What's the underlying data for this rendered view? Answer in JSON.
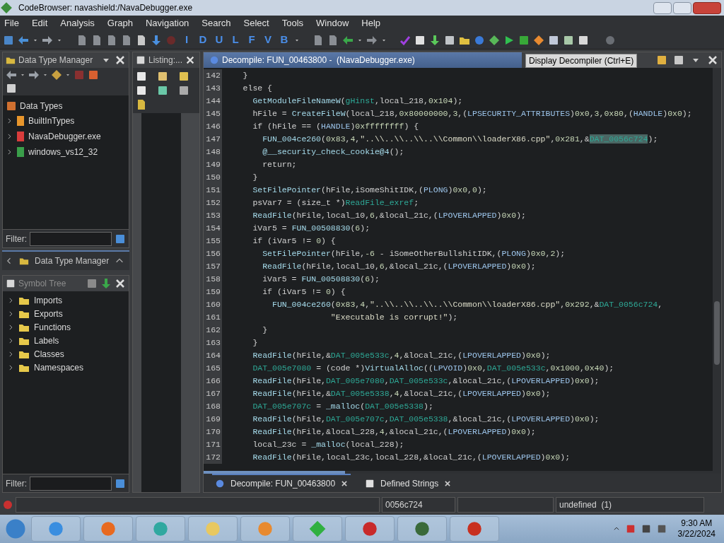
{
  "window": {
    "title": "CodeBrowser: navashield:/NavaDebugger.exe"
  },
  "menu": [
    "File",
    "Edit",
    "Analysis",
    "Graph",
    "Navigation",
    "Search",
    "Select",
    "Tools",
    "Window",
    "Help"
  ],
  "toolbar_letters": [
    "I",
    "D",
    "U",
    "L",
    "F",
    "V",
    "B"
  ],
  "tooltip": "Display Decompiler (Ctrl+E)",
  "data_type_manager": {
    "title": "Data Type Manager",
    "root": "Data Types",
    "filter_label": "Filter:",
    "items": [
      {
        "label": "BuiltInTypes",
        "color": "#e8962c"
      },
      {
        "label": "NavaDebugger.exe",
        "color": "#d83c3c"
      },
      {
        "label": "windows_vs12_32",
        "color": "#3a9e4a"
      }
    ]
  },
  "collapsed_panel": {
    "title": "Data Type Manager"
  },
  "symbol_tree": {
    "title": "Symbol Tree",
    "filter_label": "Filter:",
    "items": [
      "Imports",
      "Exports",
      "Functions",
      "Labels",
      "Classes",
      "Namespaces"
    ]
  },
  "listing": {
    "title": "Listing:..."
  },
  "decompile": {
    "title": "Decompile: FUN_00463800 -  (NavaDebugger.exe)",
    "lines": [
      {
        "n": "142",
        "tokens": [
          {
            "kind": "t",
            "text": "    }"
          }
        ]
      },
      {
        "n": "143",
        "tokens": [
          {
            "kind": "t",
            "text": "    else {"
          }
        ]
      },
      {
        "n": "144",
        "tokens": [
          {
            "kind": "f",
            "text": "      GetModuleFileNameW"
          },
          {
            "kind": "t",
            "text": "("
          },
          {
            "kind": "g",
            "text": "gHinst"
          },
          {
            "kind": "t",
            "text": ",local_218,"
          },
          {
            "kind": "n",
            "text": "0x104"
          },
          {
            "kind": "t",
            "text": ");"
          }
        ]
      },
      {
        "n": "145",
        "tokens": [
          {
            "kind": "t",
            "text": "      hFile = "
          },
          {
            "kind": "f",
            "text": "CreateFileW"
          },
          {
            "kind": "t",
            "text": "(local_218,"
          },
          {
            "kind": "n",
            "text": "0x80000000"
          },
          {
            "kind": "t",
            "text": ","
          },
          {
            "kind": "n",
            "text": "3"
          },
          {
            "kind": "t",
            "text": ",("
          },
          {
            "kind": "y",
            "text": "LPSECURITY_ATTRIBUTES"
          },
          {
            "kind": "t",
            "text": ")"
          },
          {
            "kind": "n",
            "text": "0x0"
          },
          {
            "kind": "t",
            "text": ","
          },
          {
            "kind": "n",
            "text": "3"
          },
          {
            "kind": "t",
            "text": ","
          },
          {
            "kind": "n",
            "text": "0x80"
          },
          {
            "kind": "t",
            "text": ",("
          },
          {
            "kind": "y",
            "text": "HANDLE"
          },
          {
            "kind": "t",
            "text": ")"
          },
          {
            "kind": "n",
            "text": "0x0"
          },
          {
            "kind": "t",
            "text": ");"
          }
        ]
      },
      {
        "n": "146",
        "tokens": [
          {
            "kind": "t",
            "text": "      if (hFile == ("
          },
          {
            "kind": "y",
            "text": "HANDLE"
          },
          {
            "kind": "t",
            "text": ")"
          },
          {
            "kind": "n",
            "text": "0xffffffff"
          },
          {
            "kind": "t",
            "text": ") {"
          }
        ]
      },
      {
        "n": "147",
        "tokens": [
          {
            "kind": "f",
            "text": "        FUN_004ce260"
          },
          {
            "kind": "t",
            "text": "("
          },
          {
            "kind": "n",
            "text": "0x83"
          },
          {
            "kind": "t",
            "text": ","
          },
          {
            "kind": "n",
            "text": "4"
          },
          {
            "kind": "t",
            "text": ","
          },
          {
            "kind": "s",
            "text": "\"..\\\\..\\\\..\\\\..\\\\Common\\\\loaderX86.cpp\""
          },
          {
            "kind": "t",
            "text": ","
          },
          {
            "kind": "n",
            "text": "0x281"
          },
          {
            "kind": "t",
            "text": ",&"
          },
          {
            "kind": "h",
            "text": "DAT_0056c724"
          },
          {
            "kind": "t",
            "text": ");"
          }
        ]
      },
      {
        "n": "148",
        "tokens": [
          {
            "kind": "f",
            "text": "        @__security_check_cookie@4"
          },
          {
            "kind": "t",
            "text": "();"
          }
        ]
      },
      {
        "n": "149",
        "tokens": [
          {
            "kind": "t",
            "text": "        return;"
          }
        ]
      },
      {
        "n": "150",
        "tokens": [
          {
            "kind": "t",
            "text": "      }"
          }
        ]
      },
      {
        "n": "151",
        "tokens": [
          {
            "kind": "f",
            "text": "      SetFilePointer"
          },
          {
            "kind": "t",
            "text": "(hFile,iSomeShitIDK,("
          },
          {
            "kind": "y",
            "text": "PLONG"
          },
          {
            "kind": "t",
            "text": ")"
          },
          {
            "kind": "n",
            "text": "0x0"
          },
          {
            "kind": "t",
            "text": ","
          },
          {
            "kind": "n",
            "text": "0"
          },
          {
            "kind": "t",
            "text": ");"
          }
        ]
      },
      {
        "n": "152",
        "tokens": [
          {
            "kind": "t",
            "text": "      psVar7 = (size_t *)"
          },
          {
            "kind": "g",
            "text": "ReadFile_exref"
          },
          {
            "kind": "t",
            "text": ";"
          }
        ]
      },
      {
        "n": "153",
        "tokens": [
          {
            "kind": "f",
            "text": "      ReadFile"
          },
          {
            "kind": "t",
            "text": "(hFile,local_10,"
          },
          {
            "kind": "n",
            "text": "6"
          },
          {
            "kind": "t",
            "text": ",&local_21c,("
          },
          {
            "kind": "y",
            "text": "LPOVERLAPPED"
          },
          {
            "kind": "t",
            "text": ")"
          },
          {
            "kind": "n",
            "text": "0x0"
          },
          {
            "kind": "t",
            "text": ");"
          }
        ]
      },
      {
        "n": "154",
        "tokens": [
          {
            "kind": "t",
            "text": "      iVar5 = "
          },
          {
            "kind": "f",
            "text": "FUN_00508830"
          },
          {
            "kind": "t",
            "text": "("
          },
          {
            "kind": "n",
            "text": "6"
          },
          {
            "kind": "t",
            "text": ");"
          }
        ]
      },
      {
        "n": "155",
        "tokens": [
          {
            "kind": "t",
            "text": "      if (iVar5 != "
          },
          {
            "kind": "n",
            "text": "0"
          },
          {
            "kind": "t",
            "text": ") {"
          }
        ]
      },
      {
        "n": "156",
        "tokens": [
          {
            "kind": "f",
            "text": "        SetFilePointer"
          },
          {
            "kind": "t",
            "text": "(hFile,"
          },
          {
            "kind": "n",
            "text": "-6"
          },
          {
            "kind": "t",
            "text": " - iSomeOtherBullshitIDK,("
          },
          {
            "kind": "y",
            "text": "PLONG"
          },
          {
            "kind": "t",
            "text": ")"
          },
          {
            "kind": "n",
            "text": "0x0"
          },
          {
            "kind": "t",
            "text": ","
          },
          {
            "kind": "n",
            "text": "2"
          },
          {
            "kind": "t",
            "text": ");"
          }
        ]
      },
      {
        "n": "157",
        "tokens": [
          {
            "kind": "f",
            "text": "        ReadFile"
          },
          {
            "kind": "t",
            "text": "(hFile,local_10,"
          },
          {
            "kind": "n",
            "text": "6"
          },
          {
            "kind": "t",
            "text": ",&local_21c,("
          },
          {
            "kind": "y",
            "text": "LPOVERLAPPED"
          },
          {
            "kind": "t",
            "text": ")"
          },
          {
            "kind": "n",
            "text": "0x0"
          },
          {
            "kind": "t",
            "text": ");"
          }
        ]
      },
      {
        "n": "158",
        "tokens": [
          {
            "kind": "t",
            "text": "        iVar5 = "
          },
          {
            "kind": "f",
            "text": "FUN_00508830"
          },
          {
            "kind": "t",
            "text": "("
          },
          {
            "kind": "n",
            "text": "6"
          },
          {
            "kind": "t",
            "text": ");"
          }
        ]
      },
      {
        "n": "159",
        "tokens": [
          {
            "kind": "t",
            "text": "        if (iVar5 != "
          },
          {
            "kind": "n",
            "text": "0"
          },
          {
            "kind": "t",
            "text": ") {"
          }
        ]
      },
      {
        "n": "160",
        "tokens": [
          {
            "kind": "f",
            "text": "          FUN_004ce260"
          },
          {
            "kind": "t",
            "text": "("
          },
          {
            "kind": "n",
            "text": "0x83"
          },
          {
            "kind": "t",
            "text": ","
          },
          {
            "kind": "n",
            "text": "4"
          },
          {
            "kind": "t",
            "text": ","
          },
          {
            "kind": "s",
            "text": "\"..\\\\..\\\\..\\\\..\\\\Common\\\\loaderX86.cpp\""
          },
          {
            "kind": "t",
            "text": ","
          },
          {
            "kind": "n",
            "text": "0x292"
          },
          {
            "kind": "t",
            "text": ",&"
          },
          {
            "kind": "g",
            "text": "DAT_0056c724"
          },
          {
            "kind": "t",
            "text": ","
          }
        ]
      },
      {
        "n": "161",
        "tokens": [
          {
            "kind": "s",
            "text": "                      \"Executable is corrupt!\""
          },
          {
            "kind": "t",
            "text": ");"
          }
        ]
      },
      {
        "n": "162",
        "tokens": [
          {
            "kind": "t",
            "text": "        }"
          }
        ]
      },
      {
        "n": "163",
        "tokens": [
          {
            "kind": "t",
            "text": "      }"
          }
        ]
      },
      {
        "n": "164",
        "tokens": [
          {
            "kind": "f",
            "text": "      ReadFile"
          },
          {
            "kind": "t",
            "text": "(hFile,&"
          },
          {
            "kind": "g",
            "text": "DAT_005e533c"
          },
          {
            "kind": "t",
            "text": ","
          },
          {
            "kind": "n",
            "text": "4"
          },
          {
            "kind": "t",
            "text": ",&local_21c,("
          },
          {
            "kind": "y",
            "text": "LPOVERLAPPED"
          },
          {
            "kind": "t",
            "text": ")"
          },
          {
            "kind": "n",
            "text": "0x0"
          },
          {
            "kind": "t",
            "text": ");"
          }
        ]
      },
      {
        "n": "165",
        "tokens": [
          {
            "kind": "g",
            "text": "      DAT_005e7080"
          },
          {
            "kind": "t",
            "text": " = (code *)"
          },
          {
            "kind": "f",
            "text": "VirtualAlloc"
          },
          {
            "kind": "t",
            "text": "(("
          },
          {
            "kind": "y",
            "text": "LPVOID"
          },
          {
            "kind": "t",
            "text": ")"
          },
          {
            "kind": "n",
            "text": "0x0"
          },
          {
            "kind": "t",
            "text": ","
          },
          {
            "kind": "g",
            "text": "DAT_005e533c"
          },
          {
            "kind": "t",
            "text": ","
          },
          {
            "kind": "n",
            "text": "0x1000"
          },
          {
            "kind": "t",
            "text": ","
          },
          {
            "kind": "n",
            "text": "0x40"
          },
          {
            "kind": "t",
            "text": ");"
          }
        ]
      },
      {
        "n": "166",
        "tokens": [
          {
            "kind": "f",
            "text": "      ReadFile"
          },
          {
            "kind": "t",
            "text": "(hFile,"
          },
          {
            "kind": "g",
            "text": "DAT_005e7080"
          },
          {
            "kind": "t",
            "text": ","
          },
          {
            "kind": "g",
            "text": "DAT_005e533c"
          },
          {
            "kind": "t",
            "text": ",&local_21c,("
          },
          {
            "kind": "y",
            "text": "LPOVERLAPPED"
          },
          {
            "kind": "t",
            "text": ")"
          },
          {
            "kind": "n",
            "text": "0x0"
          },
          {
            "kind": "t",
            "text": ");"
          }
        ]
      },
      {
        "n": "167",
        "tokens": [
          {
            "kind": "f",
            "text": "      ReadFile"
          },
          {
            "kind": "t",
            "text": "(hFile,&"
          },
          {
            "kind": "g",
            "text": "DAT_005e5338"
          },
          {
            "kind": "t",
            "text": ","
          },
          {
            "kind": "n",
            "text": "4"
          },
          {
            "kind": "t",
            "text": ",&local_21c,("
          },
          {
            "kind": "y",
            "text": "LPOVERLAPPED"
          },
          {
            "kind": "t",
            "text": ")"
          },
          {
            "kind": "n",
            "text": "0x0"
          },
          {
            "kind": "t",
            "text": ");"
          }
        ]
      },
      {
        "n": "168",
        "tokens": [
          {
            "kind": "g",
            "text": "      DAT_005e707c"
          },
          {
            "kind": "t",
            "text": " = "
          },
          {
            "kind": "f",
            "text": "_malloc"
          },
          {
            "kind": "t",
            "text": "("
          },
          {
            "kind": "g",
            "text": "DAT_005e5338"
          },
          {
            "kind": "t",
            "text": ");"
          }
        ]
      },
      {
        "n": "169",
        "tokens": [
          {
            "kind": "f",
            "text": "      ReadFile"
          },
          {
            "kind": "t",
            "text": "(hFile,"
          },
          {
            "kind": "g",
            "text": "DAT_005e707c"
          },
          {
            "kind": "t",
            "text": ","
          },
          {
            "kind": "g",
            "text": "DAT_005e5338"
          },
          {
            "kind": "t",
            "text": ",&local_21c,("
          },
          {
            "kind": "y",
            "text": "LPOVERLAPPED"
          },
          {
            "kind": "t",
            "text": ")"
          },
          {
            "kind": "n",
            "text": "0x0"
          },
          {
            "kind": "t",
            "text": ");"
          }
        ]
      },
      {
        "n": "170",
        "tokens": [
          {
            "kind": "f",
            "text": "      ReadFile"
          },
          {
            "kind": "t",
            "text": "(hFile,&local_228,"
          },
          {
            "kind": "n",
            "text": "4"
          },
          {
            "kind": "t",
            "text": ",&local_21c,("
          },
          {
            "kind": "y",
            "text": "LPOVERLAPPED"
          },
          {
            "kind": "t",
            "text": ")"
          },
          {
            "kind": "n",
            "text": "0x0"
          },
          {
            "kind": "t",
            "text": ");"
          }
        ]
      },
      {
        "n": "171",
        "tokens": [
          {
            "kind": "t",
            "text": "      local_23c = "
          },
          {
            "kind": "f",
            "text": "_malloc"
          },
          {
            "kind": "t",
            "text": "(local_228);"
          }
        ]
      },
      {
        "n": "172",
        "tokens": [
          {
            "kind": "f",
            "text": "      ReadFile"
          },
          {
            "kind": "t",
            "text": "(hFile,local_23c,local_228,&local_21c,("
          },
          {
            "kind": "y",
            "text": "LPOVERLAPPED"
          },
          {
            "kind": "t",
            "text": ")"
          },
          {
            "kind": "n",
            "text": "0x0"
          },
          {
            "kind": "t",
            "text": ");"
          }
        ]
      }
    ]
  },
  "bottom_tabs": [
    {
      "label": "Decompile: FUN_00463800",
      "selected": true
    },
    {
      "label": "Defined Strings",
      "selected": false
    }
  ],
  "status_bar": {
    "address": "0056c724",
    "type": "undefined  (1)"
  },
  "clock": {
    "time": "9:30 AM",
    "date": "3/22/2024"
  }
}
